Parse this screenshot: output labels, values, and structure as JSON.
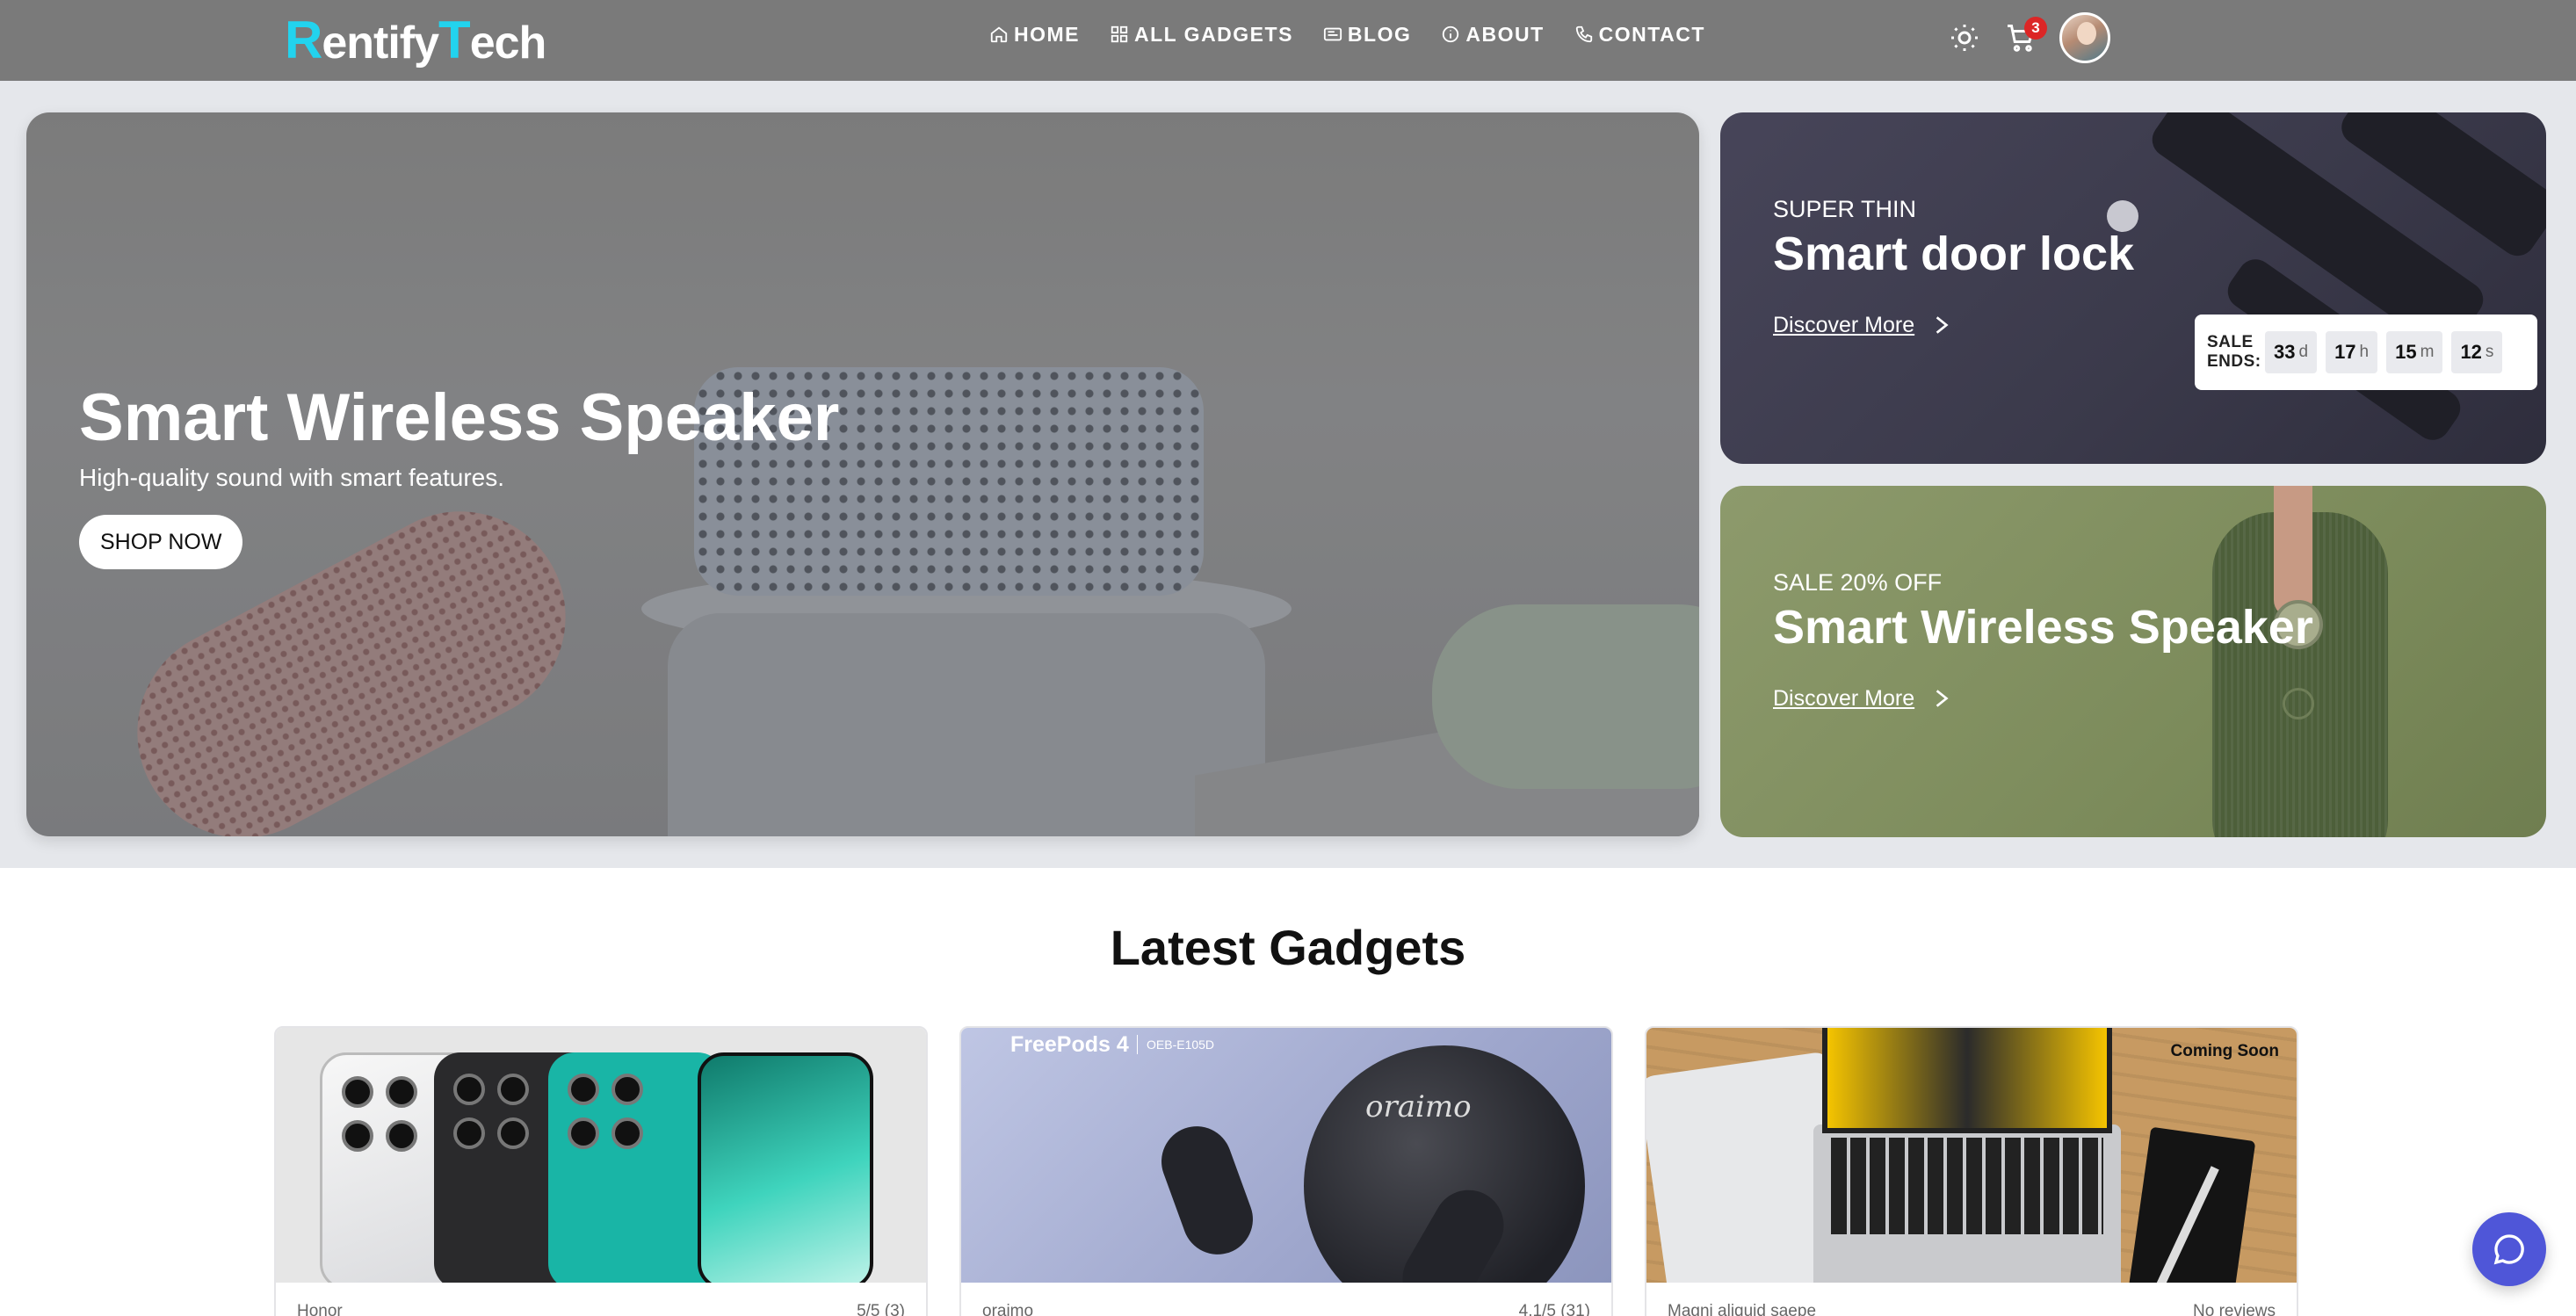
{
  "brand": {
    "logo_r": "R",
    "logo_mid": "entify",
    "logo_t": "T",
    "logo_end": "ech",
    "accent": "#22d3ee"
  },
  "nav": {
    "items": [
      {
        "label": "HOME",
        "icon": "home-icon"
      },
      {
        "label": "ALL GADGETS",
        "icon": "grid-icon"
      },
      {
        "label": "BLOG",
        "icon": "newspaper-icon"
      },
      {
        "label": "ABOUT",
        "icon": "info-icon"
      },
      {
        "label": "CONTACT",
        "icon": "phone-icon"
      }
    ]
  },
  "header": {
    "theme_icon": "sun-icon",
    "cart_icon": "cart-icon",
    "cart_count": "3"
  },
  "hero": {
    "title": "Smart Wireless Speaker",
    "subtitle": "High-quality sound with smart features.",
    "cta": "SHOP NOW"
  },
  "promo_lock": {
    "eyebrow": "SUPER THIN",
    "title": "Smart door lock",
    "link": "Discover More",
    "countdown": {
      "label_line1": "SALE",
      "label_line2": "ENDS:",
      "days": "33",
      "days_suffix": "d",
      "hours": "17",
      "hours_suffix": "h",
      "minutes": "15",
      "minutes_suffix": "m",
      "seconds": "12",
      "seconds_suffix": "s"
    }
  },
  "promo_speaker": {
    "eyebrow": "SALE 20% OFF",
    "title": "Smart Wireless Speaker",
    "link": "Discover More"
  },
  "latest": {
    "title": "Latest Gadgets",
    "products": [
      {
        "brand": "Honor",
        "rating": "5/5 (3)",
        "badge": ""
      },
      {
        "brand": "oraimo",
        "rating": "4.1/5 (31)",
        "badge": "",
        "image_title": "FreePods 4",
        "image_model": "OEB-E105D",
        "image_logo": "oraimo"
      },
      {
        "brand": "Magni aliquid saepe",
        "rating": "No reviews",
        "badge": "Coming Soon"
      }
    ]
  },
  "chat": {
    "icon": "chat-bubble-icon"
  },
  "colors": {
    "header_bg": "#7a7a7a",
    "hero_area_bg": "#e5e7eb",
    "chat_fab": "#4f56d8",
    "cart_badge": "#dc2626"
  }
}
